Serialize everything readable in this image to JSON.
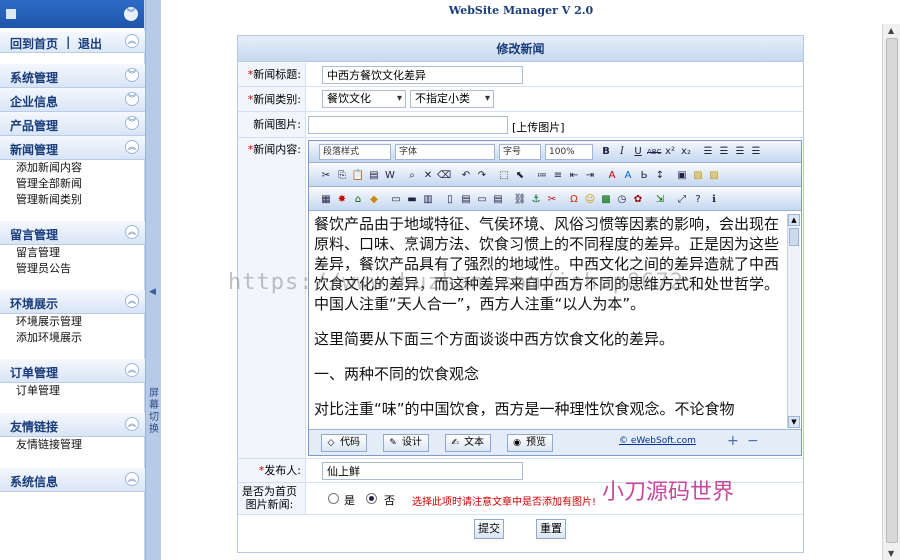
{
  "app": {
    "title": "WebSite Manager V 2.0"
  },
  "sidebar": {
    "top_links": {
      "home": "回到首页",
      "sep": "|",
      "logout": "退出"
    },
    "groups": [
      {
        "title": "系统管理",
        "items": []
      },
      {
        "title": "企业信息",
        "items": []
      },
      {
        "title": "产品管理",
        "items": []
      },
      {
        "title": "新闻管理",
        "items": [
          "添加新闻内容",
          "管理全部新闻",
          "管理新闻类别"
        ]
      },
      {
        "title": "留言管理",
        "items": [
          "留言管理",
          "管理员公告"
        ]
      },
      {
        "title": "环境展示",
        "items": [
          "环境展示管理",
          "添加环境展示"
        ]
      },
      {
        "title": "订单管理",
        "items": [
          "订单管理"
        ]
      },
      {
        "title": "友情链接",
        "items": [
          "友情链接管理"
        ]
      },
      {
        "title": "系统信息",
        "items": []
      }
    ],
    "divider_text": "屏幕切换"
  },
  "form": {
    "heading": "修改新闻",
    "title_label": "新闻标题:",
    "title_value": "中西方餐饮文化差异",
    "category_label": "新闻类别:",
    "category_value": "餐饮文化",
    "subcategory_value": "不指定小类",
    "image_label": "新闻图片:",
    "image_value": "",
    "upload_link": "[上传图片]",
    "content_label": "新闻内容:",
    "publisher_label": "发布人:",
    "publisher_value": "仙上鲜",
    "headline_label_1": "是否为首页",
    "headline_label_2": "图片新闻:",
    "radio_yes": "是",
    "radio_no": "否",
    "headline_hint": "选择此项时请注意文章中是否添加有图片!",
    "submit": "提交",
    "reset": "重置"
  },
  "editor": {
    "style_select": "段落样式",
    "font_select": "字体",
    "size_select": "字号",
    "zoom_select": "100%",
    "paragraphs": [
      "餐饮产品由于地域特征、气侯环境、风俗习惯等因素的影响，会出现在原料、口味、烹调方法、饮食习惯上的不同程度的差异。正是因为这些差异，餐饮产品具有了强烈的地域性。中西文化之间的差异造就了中西饮食文化的差异，而这种差异来自中西方不同的思维方式和处世哲学。中国人注重“天人合一”，西方人注重“以人为本”。",
      "这里简要从下面三个方面谈谈中西方饮食文化的差异。",
      "一、两种不同的饮食观念",
      "对比注重“味”的中国饮食，西方是一种理性饮食观念。不论食物"
    ],
    "tabs": [
      "代码",
      "设计",
      "文本",
      "预览"
    ],
    "brand": "© eWebSoft.com"
  },
  "watermarks": {
    "url": "https://www.huzhan.com/ishop8672",
    "cn": "小刀源码世界"
  }
}
